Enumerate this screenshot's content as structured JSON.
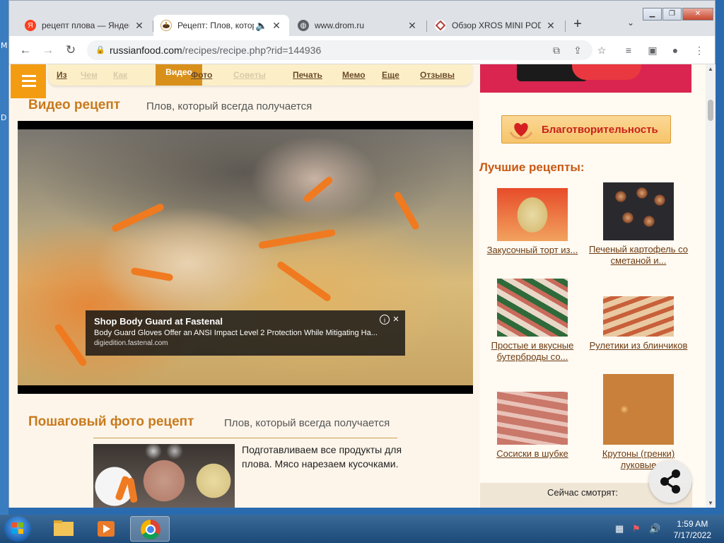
{
  "desktop": {
    "left_labels": [
      "M",
      "D"
    ]
  },
  "browser": {
    "tabs": [
      {
        "title": "рецепт плова — Яндекс",
        "favicon": "yandex-icon",
        "active": false
      },
      {
        "title": "Рецепт: Плов, который",
        "favicon": "pot-icon",
        "active": true
      },
      {
        "title": "www.drom.ru",
        "favicon": "globe-icon",
        "active": false
      },
      {
        "title": "Обзор XROS MINI POD",
        "favicon": "site-icon",
        "active": false
      }
    ],
    "new_tab": "+",
    "url": {
      "host": "russianfood.com",
      "path": "/recipes/recipe.php?rid=144936"
    }
  },
  "site_menu": {
    "items": [
      "Из",
      "Чем",
      "Как",
      "Видео",
      "Фото",
      "Советы",
      "Печать",
      "Мемо",
      "Еще",
      "Отзывы"
    ]
  },
  "video_section": {
    "title": "Видео рецепт",
    "subtitle": "Плов, который всегда получается"
  },
  "ad": {
    "title": "Shop Body Guard at Fastenal",
    "text": "Body Guard Gloves Offer an ANSI Impact Level 2 Protection While Mitigating Ha...",
    "domain": "digiedition.fastenal.com"
  },
  "photo_section": {
    "title": "Пошаговый фото рецепт",
    "subtitle": "Плов, который всегда получается",
    "step1_text": "Подготавливаем все продукты для плова. Мясо нарезаем кусочками."
  },
  "sidebar": {
    "charity_label": "Благотворительность",
    "best_title": "Лучшие рецепты:",
    "recipes": [
      {
        "caption": "Закусочный торт из..."
      },
      {
        "caption": "Печеный картофель со сметаной и..."
      },
      {
        "caption": "Простые и вкусные бутерброды со..."
      },
      {
        "caption": "Рулетики из блинчиков"
      },
      {
        "caption": "Сосиски в шубке"
      },
      {
        "caption": "Крутоны (гренки) луковые"
      }
    ],
    "watching_label": "Сейчас смотрят:"
  },
  "taskbar": {
    "time": "1:59 AM",
    "date": "7/17/2022"
  },
  "colors": {
    "accent": "#f39c12",
    "section_title": "#c87a1c",
    "sidebar_title": "#c85a14"
  }
}
